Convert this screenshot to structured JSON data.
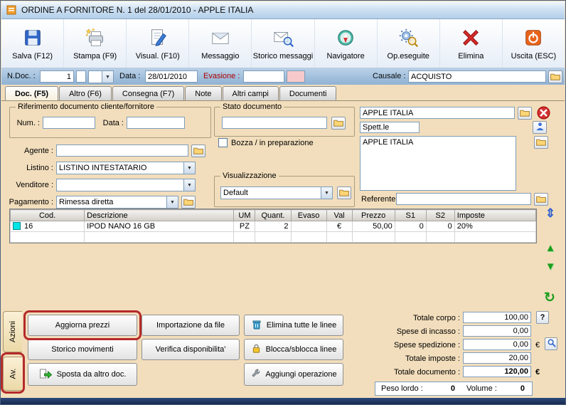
{
  "window": {
    "title": "ORDINE A FORNITORE N. 1  del 28/01/2010 - APPLE ITALIA"
  },
  "toolbar": {
    "buttons": [
      {
        "label": "Salva (F12)"
      },
      {
        "label": "Stampa (F9)"
      },
      {
        "label": "Visual. (F10)"
      },
      {
        "label": "Messaggio"
      },
      {
        "label": "Storico messaggi"
      },
      {
        "label": "Navigatore"
      },
      {
        "label": "Op.eseguite"
      },
      {
        "label": "Elimina"
      },
      {
        "label": "Uscita (ESC)"
      }
    ]
  },
  "docbar": {
    "ndoc_label": "N.Doc. :",
    "ndoc_value": "1",
    "ndoc_extra": "",
    "serie_value": "",
    "data_label": "Data :",
    "data_value": "28/01/2010",
    "evasione_label": "Evasione :",
    "evasione_value": "",
    "evasione_extra": "",
    "causale_label": "Causale :",
    "causale_value": "ACQUISTO"
  },
  "tabs": [
    "Doc. (F5)",
    "Altro (F6)",
    "Consegna (F7)",
    "Note",
    "Altri campi",
    "Documenti"
  ],
  "form": {
    "rif_group_title": "Riferimento documento cliente/fornitore",
    "num_label": "Num. :",
    "num_value": "",
    "data_label": "Data :",
    "data_value": "",
    "agente_label": "Agente :",
    "agente_value": "",
    "listino_label": "Listino :",
    "listino_value": "LISTINO INTESTATARIO",
    "venditore_label": "Venditore :",
    "venditore_value": "",
    "pagamento_label": "Pagamento :",
    "pagamento_value": "Rimessa diretta",
    "stato_group_title": "Stato documento",
    "stato_value": "",
    "bozza_label": "Bozza / in preparazione",
    "visual_group_title": "Visualizzazione",
    "visual_value": "Default",
    "intestatario_value": "APPLE ITALIA",
    "spettle_value": "Spett.le",
    "indirizzo_value": "APPLE ITALIA",
    "referente_label": "Referente",
    "referente_value": ""
  },
  "grid": {
    "columns": [
      "Cod.",
      "Descrizione",
      "UM",
      "Quant.",
      "Evaso",
      "Val",
      "Prezzo",
      "S1",
      "S2",
      "Imposte"
    ],
    "rows": [
      {
        "cod": "16",
        "descrizione": "IPOD NANO 16 GB",
        "um": "PZ",
        "quant": "2",
        "evaso": "",
        "val": "€",
        "prezzo": "50,00",
        "s1": "0",
        "s2": "0",
        "imposte": "20%"
      }
    ]
  },
  "actions": {
    "tab_azioni": "Azioni",
    "tab_av": "Av.",
    "aggiorna_prezzi": "Aggiorna prezzi",
    "importazione": "Importazione da file",
    "elimina_linee": "Elimina tutte le linee",
    "storico_movimenti": "Storico movimenti",
    "verifica": "Verifica disponibilita'",
    "blocca": "Blocca/sblocca linee",
    "sposta": "Sposta da altro doc.",
    "aggiungi": "Aggiungi operazione"
  },
  "totals": {
    "corpo_label": "Totale corpo :",
    "corpo_value": "100,00",
    "incasso_label": "Spese di incasso :",
    "incasso_value": "0,00",
    "spedizione_label": "Spese spedizione :",
    "spedizione_value": "0,00",
    "imposte_label": "Totale imposte :",
    "imposte_value": "20,00",
    "documento_label": "Totale documento :",
    "documento_value": "120,00",
    "peso_label": "Peso lordo :",
    "peso_value": "0",
    "volume_label": "Volume :",
    "volume_value": "0"
  },
  "icons": {
    "combo_arrow": "▼",
    "rows_move": "⇕",
    "row_up": "▲",
    "row_down": "▼",
    "refresh": "↻",
    "help": "?",
    "euro": "€"
  }
}
